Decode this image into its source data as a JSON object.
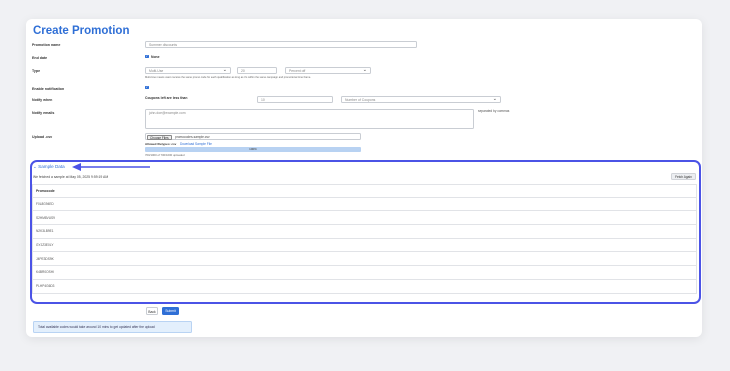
{
  "page": {
    "title": "Create Promotion"
  },
  "form": {
    "promotion_name": {
      "label": "Promotion name",
      "placeholder": "Summer discounts"
    },
    "end_date": {
      "label": "End date",
      "none_label": "None"
    },
    "type": {
      "label": "Type",
      "select_value": "Multi-Use",
      "amount": "20",
      "unit_value": "Percent off",
      "help": "Multi-Use means users receive the same promo code for each qualification as long as it's within the same campaign and promotional time frame."
    },
    "enable_notification": {
      "label": "Enable notification",
      "checked": true
    },
    "notify_when": {
      "label": "Notify when",
      "condition": "Coupons left are less than",
      "value": "10",
      "unit_value": "Number of Coupons"
    },
    "notify_emails": {
      "label": "Notify emails",
      "placeholder": "john.doe@example.com",
      "hint": "separated by commas"
    },
    "upload_csv": {
      "label": "Upload .csv",
      "choose_file": "Choose Files",
      "file_name": "promocodes-sample.csv",
      "allowed_label": "Allowed filetypes: csv",
      "download_link": "Download Sample File",
      "progress": 100,
      "progress_label": "100%",
      "progress_caption": "700/1000 of 700/1000 uploaded"
    }
  },
  "sample": {
    "title": "Sample Data",
    "fetched_text": "We fetched a sample at May 05, 2025 9:59:19 AM",
    "fetch_again": "Fetch Again",
    "column": "Promocode",
    "rows": [
      "F0L8G94ED",
      "S2HM8VUS9",
      "N2K3LB9E1",
      "GYJZ3E0LY",
      "J4PE3DS9K",
      "K4BR0OSHI",
      "PLHP4G6D3"
    ]
  },
  "actions": {
    "back": "Back",
    "submit": "Submit"
  },
  "note": "Total available codes would take around 10 mins to get updated after the upload",
  "colors": {
    "accent": "#2f6fd6",
    "highlight": "#4b53e6"
  }
}
